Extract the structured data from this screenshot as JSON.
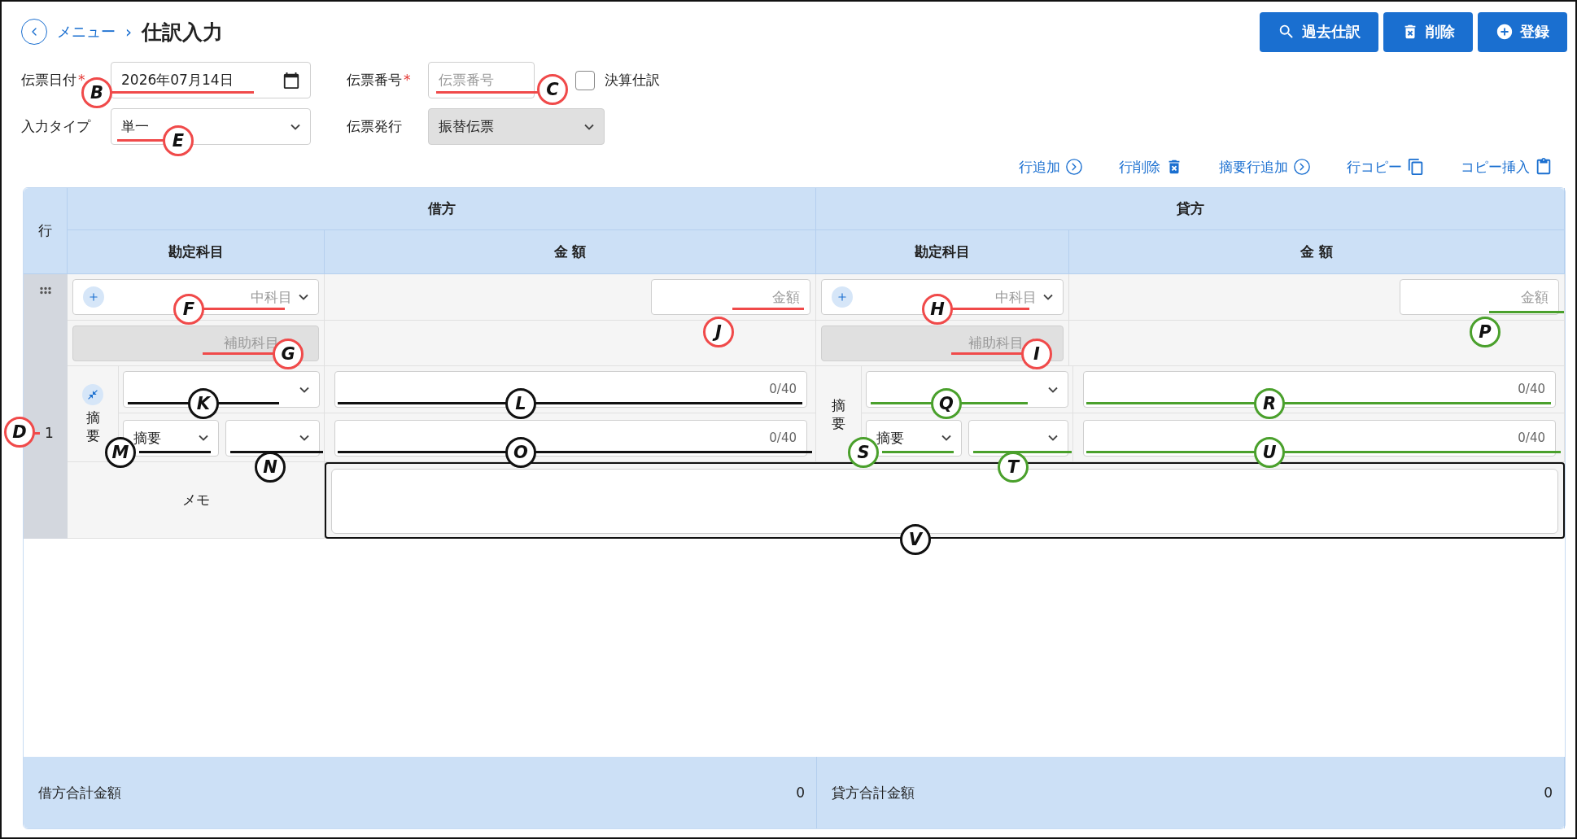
{
  "breadcrumb": {
    "parent": "メニュー",
    "separator": "›",
    "title": "仕訳入力"
  },
  "actions": [
    {
      "label": "過去仕訳"
    },
    {
      "label": "削除"
    },
    {
      "label": "登録"
    }
  ],
  "form": {
    "date": {
      "label": "伝票日付",
      "required_mark": "*",
      "value": "2026年07月14日",
      "marker": {
        "letter": "B",
        "color": "#f04a4a"
      }
    },
    "number": {
      "label": "伝票番号",
      "required_mark": "*",
      "placeholder": "伝票番号",
      "marker": {
        "letter": "C",
        "color": "#f04a4a"
      }
    },
    "closing": {
      "label": "決算仕訳",
      "checked": false
    },
    "input_type": {
      "label": "入力タイプ",
      "value": "単一",
      "marker": {
        "letter": "E",
        "color": "#f04a4a"
      }
    },
    "issue": {
      "label": "伝票発行",
      "value": "振替伝票",
      "disabled": true
    }
  },
  "row_tools": [
    {
      "label": "行追加"
    },
    {
      "label": "行削除"
    },
    {
      "label": "摘要行追加"
    },
    {
      "label": "行コピー"
    },
    {
      "label": "コピー挿入"
    }
  ],
  "table": {
    "row_header": "行",
    "sides": [
      {
        "title": "借方",
        "account_header": "勘定科目",
        "amount_header": "金 額",
        "account": {
          "placeholder": "中科目",
          "marker": {
            "letter": "F",
            "color": "#f04a4a"
          }
        },
        "sub_account": {
          "placeholder": "補助科目",
          "disabled": true,
          "marker": {
            "letter": "G",
            "color": "#f04a4a"
          }
        },
        "amount": {
          "placeholder": "金額",
          "marker": {
            "letter": "J",
            "color": "#f04a4a"
          }
        },
        "summary_label": "摘要",
        "collapsible": true,
        "summary_select": {
          "marker": {
            "letter": "K",
            "color": "#111111"
          }
        },
        "summary_text": {
          "counter": "0/40",
          "marker": {
            "letter": "L",
            "color": "#111111"
          }
        },
        "summary_kind": {
          "value": "摘要",
          "marker": {
            "letter": "M",
            "color": "#111111"
          }
        },
        "summary_select2": {
          "marker": {
            "letter": "N",
            "color": "#111111"
          }
        },
        "summary_text2": {
          "counter": "0/40",
          "marker": {
            "letter": "O",
            "color": "#111111"
          }
        }
      },
      {
        "title": "貸方",
        "account_header": "勘定科目",
        "amount_header": "金 額",
        "account": {
          "placeholder": "中科目",
          "marker": {
            "letter": "H",
            "color": "#f04a4a"
          }
        },
        "sub_account": {
          "placeholder": "補助科目",
          "disabled": true,
          "marker": {
            "letter": "I",
            "color": "#f04a4a"
          }
        },
        "amount": {
          "placeholder": "金額",
          "marker": {
            "letter": "P",
            "color": "#4aa02c"
          }
        },
        "summary_label": "摘要",
        "collapsible": false,
        "summary_select": {
          "marker": {
            "letter": "Q",
            "color": "#4aa02c"
          }
        },
        "summary_text": {
          "counter": "0/40",
          "marker": {
            "letter": "R",
            "color": "#4aa02c"
          }
        },
        "summary_kind": {
          "value": "摘要",
          "marker": {
            "letter": "S",
            "color": "#4aa02c"
          }
        },
        "summary_select2": {
          "marker": {
            "letter": "T",
            "color": "#4aa02c"
          }
        },
        "summary_text2": {
          "counter": "0/40",
          "marker": {
            "letter": "U",
            "color": "#4aa02c"
          }
        }
      }
    ],
    "rows": [
      {
        "number": "1",
        "marker": {
          "letter": "D",
          "color": "#f04a4a"
        },
        "memo_label": "メモ",
        "memo_marker": {
          "letter": "V",
          "color": "#111111",
          "kind": "box"
        }
      }
    ]
  },
  "totals": [
    {
      "label": "借方合計金額",
      "value": "0"
    },
    {
      "label": "貸方合計金額",
      "value": "0"
    }
  ]
}
